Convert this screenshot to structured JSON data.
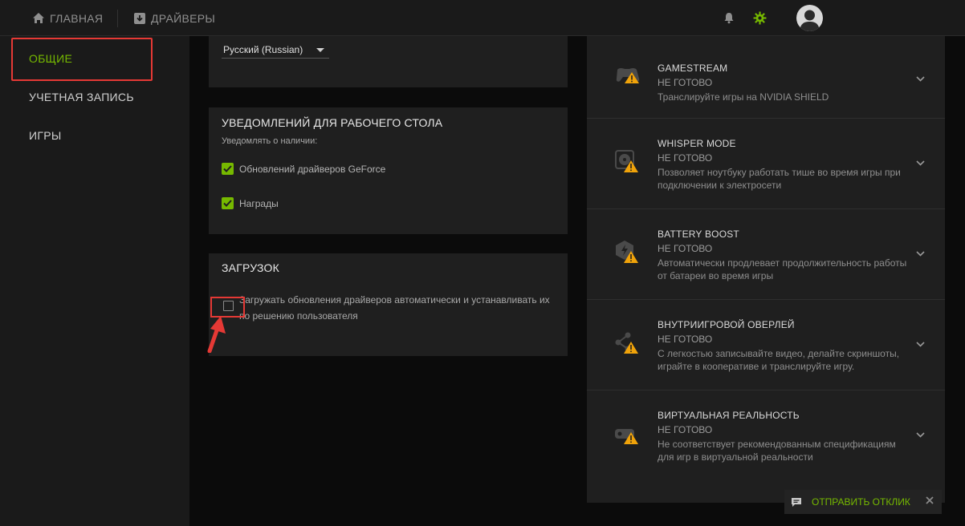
{
  "topbar": {
    "home_label": "ГЛАВНАЯ",
    "drivers_label": "ДРАЙВЕРЫ",
    "icons": [
      "home-icon",
      "drivers-icon",
      "bell-icon",
      "gear-icon",
      "avatar"
    ]
  },
  "sidebar": {
    "items": [
      {
        "label": "ОБЩИЕ",
        "active": true
      },
      {
        "label": "УЧЕТНАЯ ЗАПИСЬ",
        "active": false
      },
      {
        "label": "ИГРЫ",
        "active": false
      }
    ]
  },
  "language": {
    "selected": "Русский (Russian)"
  },
  "notifications": {
    "title": "УВЕДОМЛЕНИЙ ДЛЯ РАБОЧЕГО СТОЛА",
    "subtitle": "Уведомлять о наличии:",
    "options": [
      {
        "label": "Обновлений драйверов GeForce",
        "checked": true
      },
      {
        "label": "Награды",
        "checked": true
      }
    ]
  },
  "downloads": {
    "title": "ЗАГРУЗОК",
    "option_line1": "Загружать обновления драйверов автоматически и устанавливать их",
    "option_line2": "по решению пользователя",
    "checked": false
  },
  "features": [
    {
      "title": "GAMESTREAM",
      "status": "НЕ ГОТОВО",
      "desc1": "Транслируйте игры на NVIDIA SHIELD",
      "desc2": "",
      "icon": "gamepad-warning-icon"
    },
    {
      "title": "WHISPER MODE",
      "status": "НЕ ГОТОВО",
      "desc1": "Позволяет ноутбуку работать тише во время игры при",
      "desc2": "подключении к электросети",
      "icon": "fan-warning-icon"
    },
    {
      "title": "BATTERY BOOST",
      "status": "НЕ ГОТОВО",
      "desc1": "Автоматически продлевает продолжительность работы",
      "desc2": "от батареи во время игры",
      "icon": "battery-warning-icon"
    },
    {
      "title": "ВНУТРИИГРОВОЙ ОВЕРЛЕЙ",
      "status": "НЕ ГОТОВО",
      "desc1": "С легкостью записывайте видео, делайте скриншоты,",
      "desc2": "играйте в кооперативе и транслируйте игру.",
      "icon": "share-warning-icon"
    },
    {
      "title": "ВИРТУАЛЬНАЯ РЕАЛЬНОСТЬ",
      "status": "НЕ ГОТОВО",
      "desc1": "Не соответствует рекомендованным спецификациям",
      "desc2": "для игр в виртуальной реальности",
      "icon": "vr-warning-icon"
    }
  ],
  "feedback": {
    "label": "ОТПРАВИТЬ ОТКЛИК"
  },
  "colors": {
    "accent": "#76b900",
    "highlight": "#e53935",
    "warning": "#f0a30a"
  }
}
